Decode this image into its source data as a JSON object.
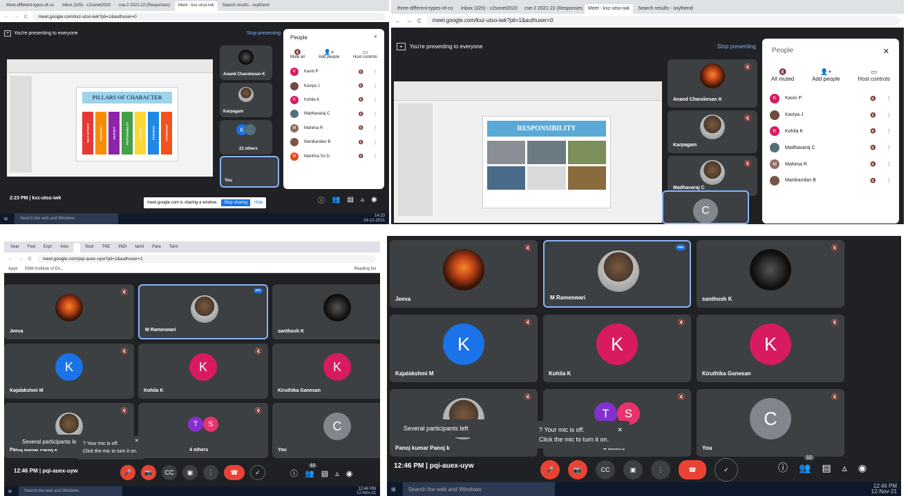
{
  "p1": {
    "tabs": [
      "three-different-types-of-co",
      "Inbox (325) - c2sonet2020",
      "cse-2 2021-22 (Responses)",
      "Meet - kxz-utso-iwk",
      "Search results - oxyfriend"
    ],
    "url": "meet.google.com/kxz-utso-iwk?pli=1&authuser=0",
    "banner": "You're presenting to everyone",
    "stop": "Stop presenting",
    "slide_title": "PILLARS OF CHARACTER",
    "pillars": [
      "SELF ESTEEM",
      "POSITIVITY",
      "RESPECT",
      "RESPONSIBILITY",
      "HONESTY",
      "KINDNESS",
      "CITIZENSHIP"
    ],
    "tiles": [
      "Anand Charukesan K",
      "Karpagam",
      "22 others",
      "You"
    ],
    "people_title": "People",
    "people_actions": [
      "Mute all",
      "Add people",
      "Host controls"
    ],
    "people": [
      {
        "n": "Kavin P",
        "i": "K",
        "c": "#d81b60"
      },
      {
        "n": "Kaviya J",
        "i": "",
        "c": "#6d4c41"
      },
      {
        "n": "Kohila K",
        "i": "K",
        "c": "#d81b60"
      },
      {
        "n": "Madhavaraj C",
        "i": "",
        "c": "#546e7a"
      },
      {
        "n": "Mahima R",
        "i": "M",
        "c": "#8d6e63"
      },
      {
        "n": "Manikandan B",
        "i": "",
        "c": "#795548"
      },
      {
        "n": "Manthra Sri D",
        "i": "M",
        "c": "#e64a19"
      }
    ],
    "time": "2:23 PM",
    "sep": "|",
    "code": "kxz-utso-iwk",
    "share_msg": "meet.google.com is sharing a window.",
    "share_stop": "Stop sharing",
    "share_hide": "Hide",
    "taskbar_search": "Search the web and Windows",
    "clock": "14:23",
    "date": "24-12-2021"
  },
  "p2": {
    "tabs": [
      "three-different-types-of-co",
      "Inbox (325) - c2sonet2020",
      "cse-2 2021-22 (Responses)",
      "Meet - kxz-utso-iwk",
      "Search results - oxyfriend"
    ],
    "url": "meet.google.com/kxz-utso-iwk?pli=1&authuser=0",
    "banner": "You're presenting to everyone",
    "stop": "Stop presenting",
    "slide_title": "RESPONSIBILITY",
    "tiles": [
      "Anand Charukesan K",
      "Karpagam",
      "Madhavaraj C"
    ],
    "you_initial": "C",
    "people_title": "People",
    "people_actions": [
      "All muted",
      "Add people",
      "Host controls"
    ],
    "people": [
      {
        "n": "Kavin P",
        "i": "K",
        "c": "#d81b60"
      },
      {
        "n": "Kaviya J",
        "i": "",
        "c": "#6d4c41"
      },
      {
        "n": "Kohila K",
        "i": "K",
        "c": "#d81b60"
      },
      {
        "n": "Madhavaraj C",
        "i": "",
        "c": "#546e7a"
      },
      {
        "n": "Mahima R",
        "i": "M",
        "c": "#8d6e63"
      },
      {
        "n": "Manikandan B",
        "i": "",
        "c": "#795548"
      }
    ]
  },
  "p3": {
    "tabs": [
      "Sear",
      "Fwd",
      "Expr",
      "Inbo",
      "",
      "Stud",
      "TNE",
      "INDI",
      "tamil",
      "Para",
      "Tami"
    ],
    "url": "meet.google.com/pqi-auex-uyw?pli=1&authuser=1",
    "bookmarks": [
      "Apps",
      "SSM Institute of En..."
    ],
    "reading": "Reading list",
    "tiles": [
      {
        "n": "Jeeva",
        "t": "photo"
      },
      {
        "n": "M Rameswari",
        "t": "person"
      },
      {
        "n": "santhosh K",
        "t": "dark"
      },
      {
        "n": "Kajalakshmi M",
        "i": "K",
        "c": "#1a73e8"
      },
      {
        "n": "Kohila K",
        "i": "K",
        "c": "#d81b60"
      },
      {
        "n": "Kiruthika Ganesan",
        "i": "K",
        "c": "#d81b60"
      },
      {
        "n": "Panoj kumar Panoj k",
        "t": "person"
      },
      {
        "n": "4 others",
        "i2": [
          "T",
          "S"
        ]
      },
      {
        "n": "You",
        "i": "C",
        "c": "#80868b"
      }
    ],
    "toast1": "Several participants left the meeting",
    "toast2a": "? Your mic is off.",
    "toast2b": "Click the mic to turn it on.",
    "time": "12:46 PM",
    "sep": "|",
    "code": "pqi-auex-uyw",
    "count": "12",
    "taskbar_search": "Search the web and Windows",
    "clock": "12:46 PM",
    "date": "12-Nov-21"
  },
  "p4": {
    "tiles": [
      {
        "n": "Jeeva",
        "t": "photo"
      },
      {
        "n": "M Rameswari",
        "t": "person"
      },
      {
        "n": "santhosh K",
        "t": "dark"
      },
      {
        "n": "Kajalakshmi M",
        "i": "K",
        "c": "#1a73e8"
      },
      {
        "n": "Kohila K",
        "i": "K",
        "c": "#d81b60"
      },
      {
        "n": "Kiruthika Ganesan",
        "i": "K",
        "c": "#d81b60"
      },
      {
        "n": "Panoj kumar Panoj k",
        "t": "person"
      },
      {
        "n": "4 others",
        "i2": [
          "T",
          "S"
        ]
      },
      {
        "n": "You",
        "i": "C",
        "c": "#80868b"
      }
    ],
    "toast1": "Several participants left the meeting",
    "toast2a": "? Your mic is off.",
    "toast2b": "Click the mic to turn it on.",
    "time": "12:46 PM",
    "sep": "|",
    "code": "pqi-auex-uyw",
    "count": "12",
    "taskbar_search": "Search the web and Windows",
    "clock": "12:46 PM",
    "date": "12-Nov-21"
  }
}
